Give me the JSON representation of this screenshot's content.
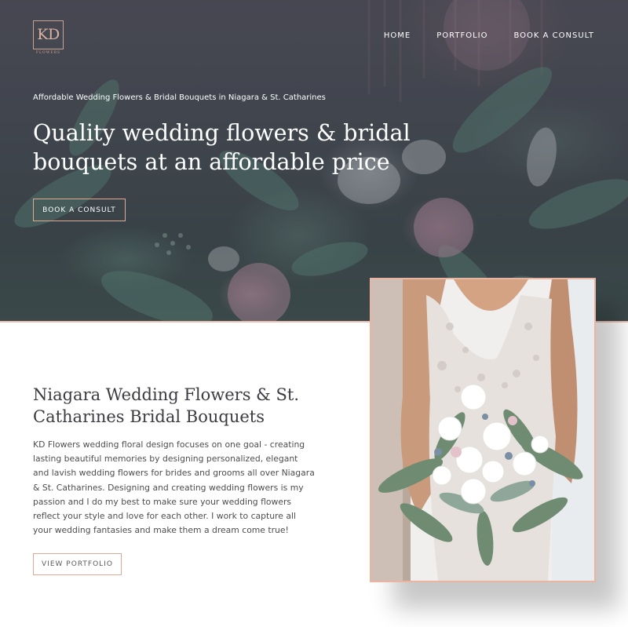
{
  "header": {
    "logo": {
      "mark": "KD",
      "sub": "FLOWERS"
    },
    "nav": [
      {
        "label": "HOME"
      },
      {
        "label": "PORTFOLIO"
      },
      {
        "label": "BOOK A CONSULT"
      }
    ]
  },
  "hero": {
    "eyebrow": "Affordable Wedding Flowers & Bridal Bouquets in Niagara & St. Catharines",
    "headline_line1": "Quality wedding flowers & bridal",
    "headline_line2": "bouquets at an affordable price",
    "cta_label": "BOOK A CONSULT",
    "background_image": "flowers-bouquet-photo"
  },
  "about": {
    "title_line1": "Niagara Wedding Flowers & St.",
    "title_line2": "Catharines Bridal Bouquets",
    "body": "KD Flowers wedding floral design focuses on one goal - creating lasting beautiful memories by designing personalized, elegant and lavish wedding flowers for brides and grooms all over Niagara & St. Catharines. Designing and creating wedding flowers is my passion and I do my best to make sure your wedding flowers reflect your style and love for each other. I work to capture all your wedding fantasies and make them a dream come true!",
    "cta_label": "VIEW PORTFOLIO",
    "photo": "bride-holding-bouquet-photo"
  },
  "colors": {
    "accent": "#e1a992",
    "logo": "#c8a292",
    "heading": "#3b3b42",
    "body_text": "#4d4d4d"
  }
}
